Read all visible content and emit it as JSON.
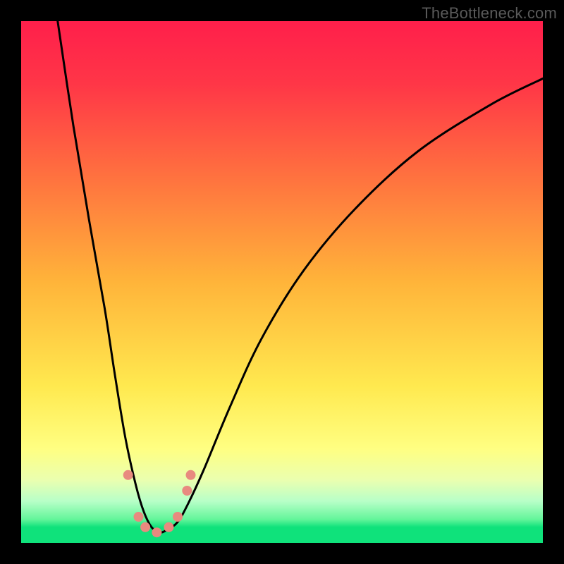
{
  "watermark": "TheBottleneck.com",
  "chart_data": {
    "type": "line",
    "title": "",
    "xlabel": "",
    "ylabel": "",
    "xlim": [
      0,
      100
    ],
    "ylim": [
      0,
      100
    ],
    "gradient_stops": [
      {
        "offset": 0,
        "color": "#ff1f4b"
      },
      {
        "offset": 0.12,
        "color": "#ff3647"
      },
      {
        "offset": 0.3,
        "color": "#ff723f"
      },
      {
        "offset": 0.5,
        "color": "#ffb43a"
      },
      {
        "offset": 0.7,
        "color": "#ffe94f"
      },
      {
        "offset": 0.82,
        "color": "#ffff82"
      },
      {
        "offset": 0.88,
        "color": "#eaffb0"
      },
      {
        "offset": 0.92,
        "color": "#b8ffc8"
      },
      {
        "offset": 0.955,
        "color": "#63f59a"
      },
      {
        "offset": 0.97,
        "color": "#0fe27b"
      },
      {
        "offset": 1.0,
        "color": "#0fe27b"
      }
    ],
    "series": [
      {
        "name": "bottleneck-curve",
        "x": [
          7,
          10,
          13,
          16,
          18,
          20,
          22,
          23.5,
          25,
          26.5,
          28,
          30,
          32,
          35,
          40,
          46,
          54,
          64,
          76,
          90,
          100
        ],
        "y": [
          100,
          80,
          62,
          45,
          32,
          20,
          11,
          6,
          3,
          2,
          2.5,
          4,
          7.5,
          14,
          26,
          39,
          52,
          64,
          75,
          84,
          89
        ]
      }
    ],
    "markers": [
      {
        "x": 20.5,
        "y": 13,
        "r": 7
      },
      {
        "x": 22.5,
        "y": 5,
        "r": 7
      },
      {
        "x": 23.8,
        "y": 3,
        "r": 7
      },
      {
        "x": 26.0,
        "y": 2,
        "r": 7
      },
      {
        "x": 28.3,
        "y": 3,
        "r": 7
      },
      {
        "x": 30.0,
        "y": 5,
        "r": 7
      },
      {
        "x": 31.8,
        "y": 10,
        "r": 7
      },
      {
        "x": 32.5,
        "y": 13,
        "r": 7
      }
    ],
    "marker_color": "#e88a7f"
  }
}
